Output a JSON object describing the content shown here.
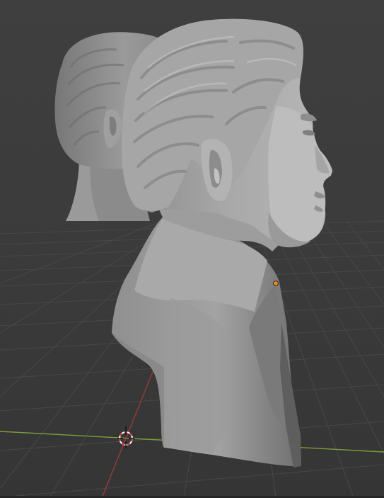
{
  "app": "3D viewport",
  "viewport": {
    "background_color": "#3d3d3d",
    "grid_color": "#4a4a4a",
    "x_axis_color": "#7e9b3a",
    "y_axis_color": "#9a3a3a",
    "origin_dot_color": "#f08a1c",
    "objects": [
      {
        "name": "bust-front",
        "kind": "sculpt-mesh",
        "color": "#9c9c9c"
      },
      {
        "name": "bust-back",
        "kind": "sculpt-mesh",
        "color": "#8d8d8d"
      }
    ],
    "cursor": {
      "icon": "3d-cursor-icon"
    }
  }
}
